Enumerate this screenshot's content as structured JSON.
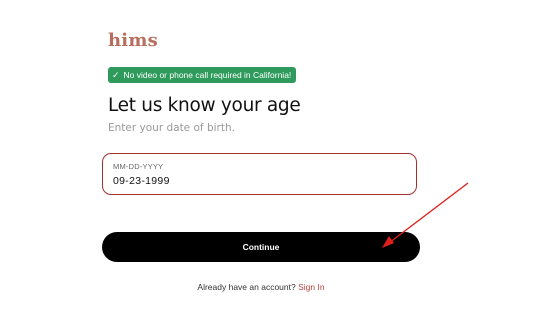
{
  "brand": {
    "logo_text": "hims",
    "logo_color": "#b76e5e"
  },
  "badge": {
    "icon": "check-icon",
    "text": "No video or phone call required in California!",
    "color": "#2e9a5b"
  },
  "heading": "Let us know your age",
  "subtitle": "Enter your date of birth.",
  "subtitle_color": "#9a9a9a",
  "dob_field": {
    "placeholder": "MM-DD-YYYY",
    "value": "09-23-1999",
    "border_color": "#a4302e"
  },
  "continue_button": {
    "label": "Continue",
    "color": "#000000"
  },
  "signin": {
    "prompt": "Already have an account?",
    "link_label": "Sign In",
    "link_color": "#b7423a"
  },
  "annotation": {
    "arrow_color": "#e0201b"
  }
}
